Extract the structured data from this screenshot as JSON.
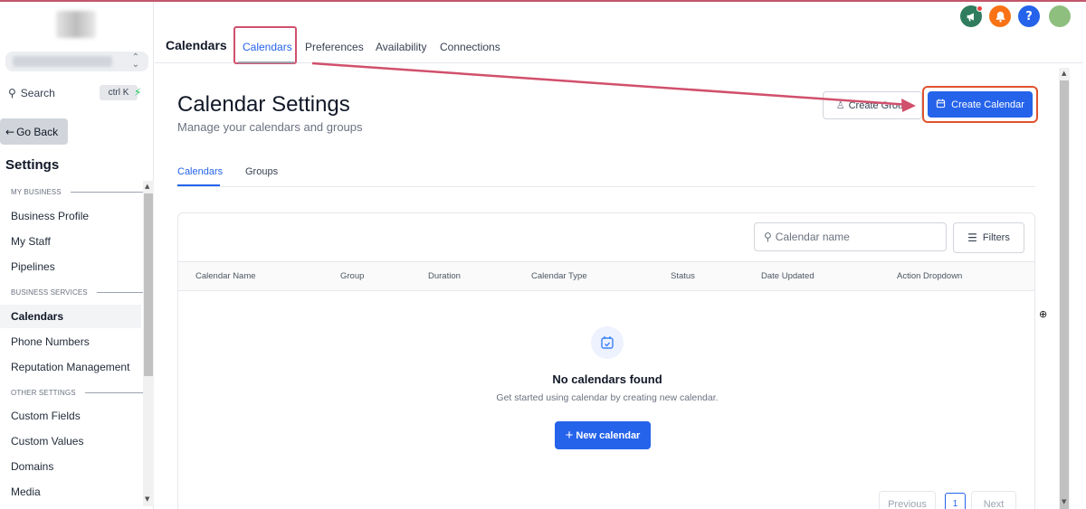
{
  "sidebar": {
    "search_label": "Search",
    "search_shortcut": "ctrl K",
    "go_back": "Go Back",
    "title": "Settings",
    "sections": {
      "my_business": "MY BUSINESS",
      "business_services": "BUSINESS SERVICES",
      "other_settings": "OTHER SETTINGS"
    },
    "items": {
      "business_profile": "Business Profile",
      "my_staff": "My Staff",
      "pipelines": "Pipelines",
      "calendars": "Calendars",
      "phone_numbers": "Phone Numbers",
      "reputation_management": "Reputation Management",
      "custom_fields": "Custom Fields",
      "custom_values": "Custom Values",
      "domains": "Domains",
      "media": "Media"
    }
  },
  "header": {
    "title": "Calendars",
    "tabs": {
      "calendars": "Calendars",
      "preferences": "Preferences",
      "availability": "Availability",
      "connections": "Connections"
    },
    "icons": {
      "announcements": {
        "icon": "megaphone-icon",
        "color": "#2f7d5e"
      },
      "notifications": {
        "icon": "bell-icon",
        "color": "#f97316"
      },
      "help": {
        "icon": "question-icon",
        "color": "#2563eb",
        "glyph": "?"
      },
      "avatar": {
        "color": "#8fbf7f"
      }
    }
  },
  "main": {
    "page_title": "Calendar Settings",
    "page_subtitle": "Manage your calendars and groups",
    "create_group": "Create Group",
    "create_calendar": "Create Calendar",
    "subtabs": {
      "calendars": "Calendars",
      "groups": "Groups"
    },
    "search_placeholder": "Calendar name",
    "filters": "Filters",
    "columns": {
      "calendar_name": "Calendar Name",
      "group": "Group",
      "duration": "Duration",
      "calendar_type": "Calendar Type",
      "status": "Status",
      "date_updated": "Date Updated",
      "action_dropdown": "Action Dropdown"
    },
    "empty_title": "No calendars found",
    "empty_subtitle": "Get started using calendar by creating new calendar.",
    "new_calendar": "New calendar",
    "pager": {
      "previous": "Previous",
      "page": "1",
      "next": "Next"
    }
  },
  "colors": {
    "accent": "#2563eb",
    "annotation": "#d1506c",
    "annotation_box": "#e0522e"
  }
}
